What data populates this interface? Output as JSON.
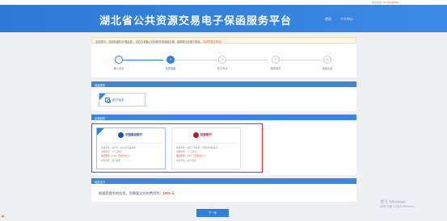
{
  "topbar": {
    "hotline_label": "服务热线:",
    "hotline_number": "027-87310000"
  },
  "header": {
    "title": "湖北省公共资源交易电子保函服务平台",
    "nav": [
      "首页",
      "个人中心"
    ]
  },
  "notice": {
    "prefix": "友情提示：",
    "text": "当前选择的为“保证金”，请在交易截止时间前完成保函办理，逾期将无法参与投标。",
    "highlight": "请尽早提交申请！"
  },
  "steps": [
    {
      "num": "✓",
      "label": "确认信息",
      "state": "done"
    },
    {
      "num": "2",
      "label": "选择保函",
      "state": "active"
    },
    {
      "num": "3",
      "label": "提交申请",
      "state": "todo"
    },
    {
      "num": "4",
      "label": "缴纳保费",
      "state": "todo"
    },
    {
      "num": "5",
      "label": "保函出函",
      "state": "todo"
    }
  ],
  "guarantee_type": {
    "section_title": "保函类型",
    "card_label": "银行保函"
  },
  "institution": {
    "section_title": "出函机构",
    "banks": [
      {
        "name": "中国建设银行",
        "color": "#1f4ea8",
        "selected": true,
        "lines": [
          "申请条件：在开户、征信状况良好的",
          "出函时间：1个工作日",
          "保函费率：0.5%（最低300元）",
          "支付方式：银行转账"
        ]
      },
      {
        "name": "招商银行",
        "color": "#c8102e",
        "selected": false,
        "lines": [
          "申请条件：满足下列条件，经银行审核通过",
          "出函时间：1个工作日",
          "保函费率：0.5%（最低300元）",
          "支付方式：线下支付"
        ]
      }
    ]
  },
  "fee": {
    "section_title": "保费支付",
    "text": "根据您提交的信息，您需要支付的费用为：",
    "amount": "1000",
    "unit": "元"
  },
  "next_button": "下一步",
  "watermark": {
    "line1": "激活 Windows",
    "line2": "转到“设置”以激活 Windows。"
  },
  "colors": {
    "primary": "#2f7fe0",
    "header_bg": "#3b8ae6",
    "alert": "#e22a2a"
  },
  "icons": {
    "type_card": "certificate-icon",
    "step_done": "check-icon"
  }
}
